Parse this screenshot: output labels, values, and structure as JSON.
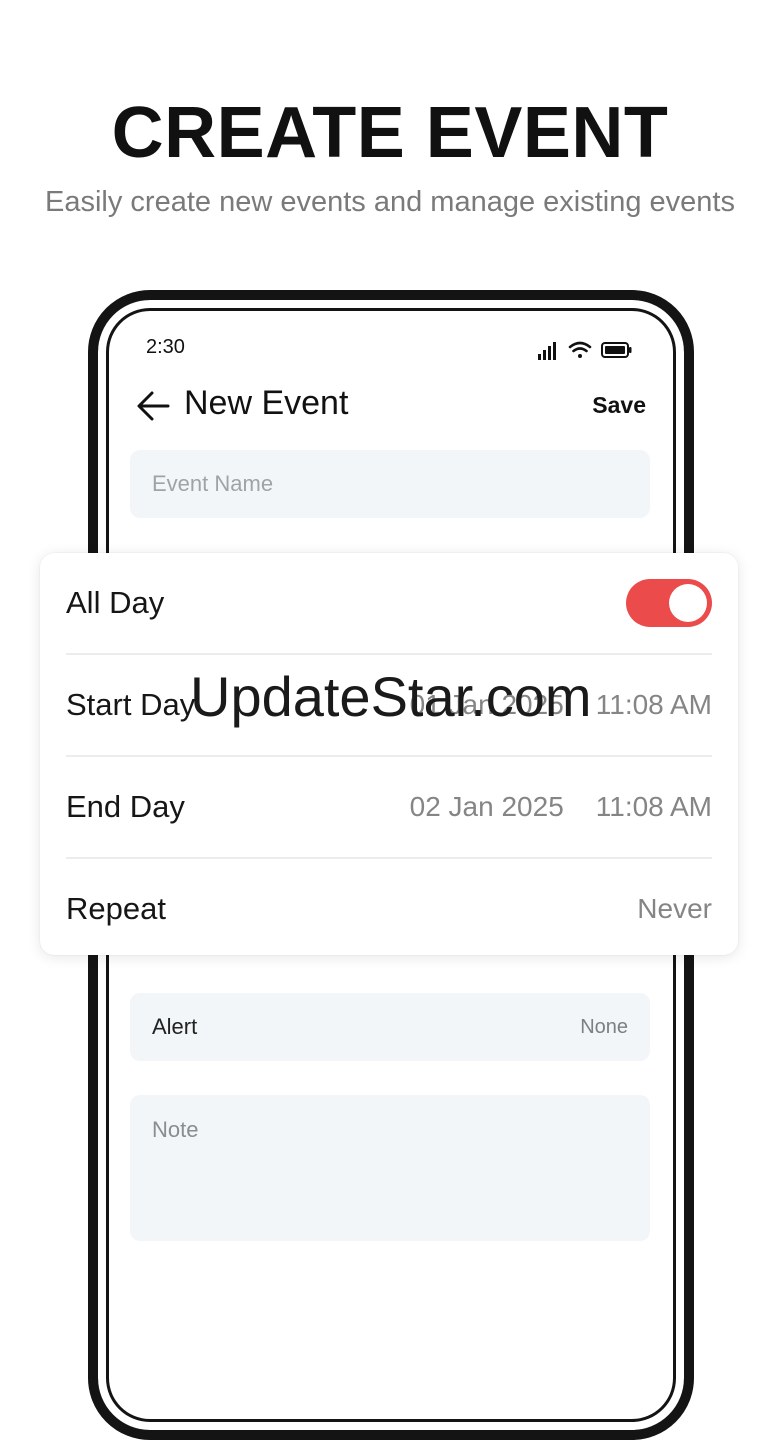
{
  "promo": {
    "headline": "CREATE EVENT",
    "subheadline": "Easily create new events and manage existing events"
  },
  "status_bar": {
    "time": "2:30",
    "icons": [
      "signal-icon",
      "wifi-icon",
      "battery-icon"
    ]
  },
  "app_bar": {
    "back_icon": "arrow-left-icon",
    "title": "New Event",
    "save_label": "Save"
  },
  "form": {
    "event_name_placeholder": "Event Name",
    "all_day": {
      "label": "All Day",
      "enabled": true
    },
    "start_day": {
      "label": "Start Day",
      "date": "01 Jan 2025",
      "time": "11:08 AM"
    },
    "end_day": {
      "label": "End Day",
      "date": "02 Jan 2025",
      "time": "11:08 AM"
    },
    "repeat": {
      "label": "Repeat",
      "value": "Never"
    },
    "alert": {
      "label": "Alert",
      "value": "None"
    },
    "note_placeholder": "Note"
  },
  "watermark": "UpdateStar.com",
  "colors": {
    "accent": "#ec4b4b",
    "field_bg": "#f3f6f9",
    "muted_text": "#858585"
  }
}
